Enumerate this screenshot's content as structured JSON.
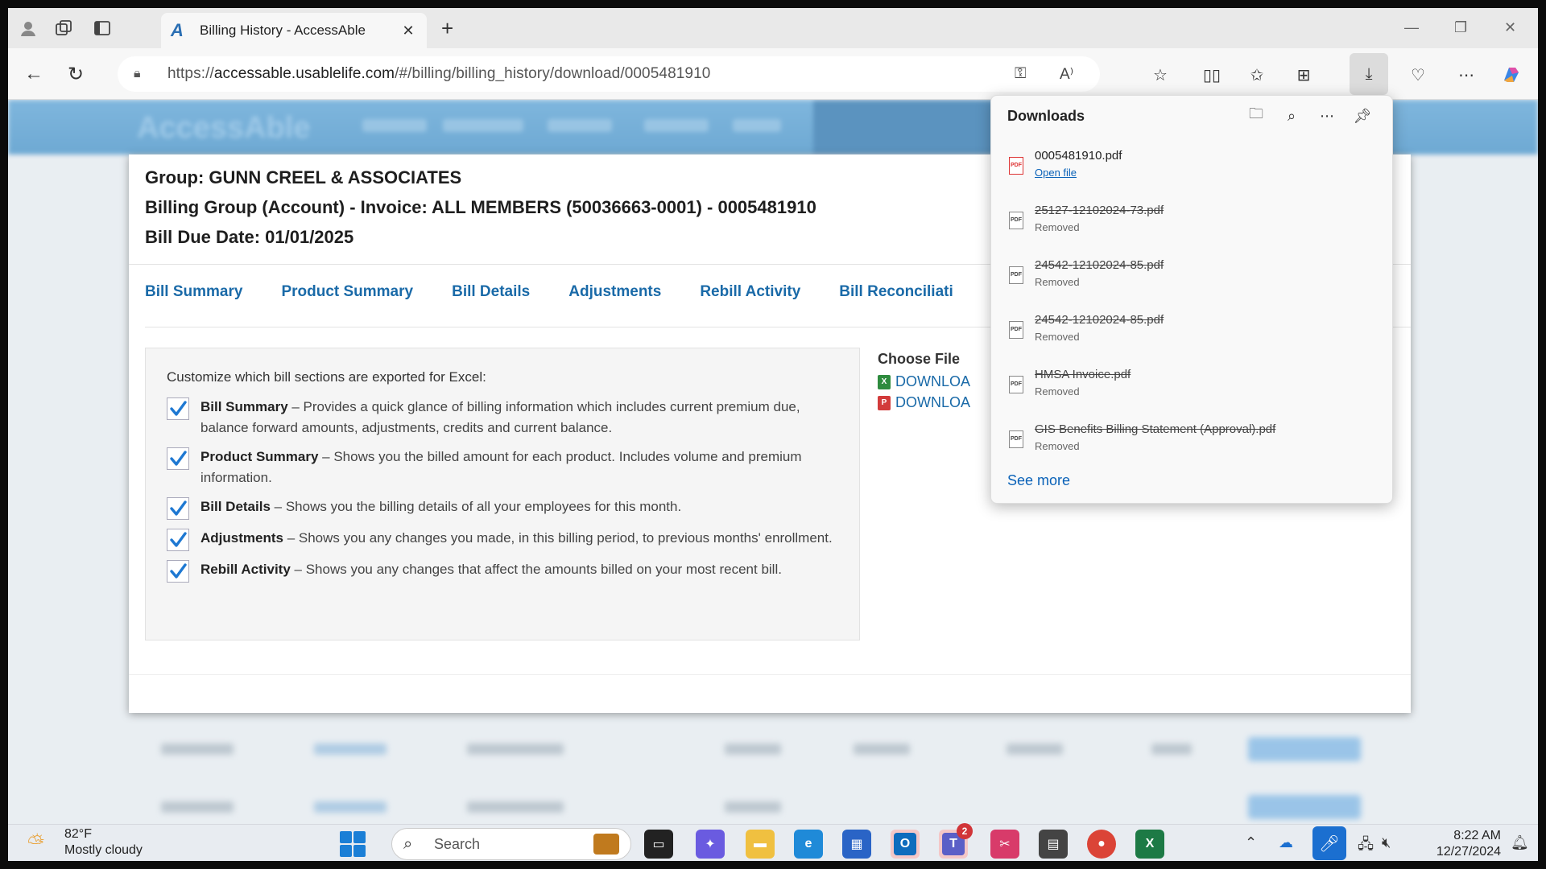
{
  "browser": {
    "tab_title": "Billing History - AccessAble",
    "tab_favicon": "A",
    "url_prefix": "https://",
    "url_host": "accessable.usablelife.com",
    "url_path": "/#/billing/billing_history/download/0005481910",
    "read_aloud": "A⁾"
  },
  "modal": {
    "group": "Group: GUNN CREEL & ASSOCIATES",
    "billing_group": "Billing Group (Account) - Invoice:  ALL MEMBERS (50036663-0001) - 0005481910",
    "due_date": "Bill Due Date: 01/01/2025",
    "tabs": [
      "Bill Summary",
      "Product Summary",
      "Bill Details",
      "Adjustments",
      "Rebill Activity",
      "Bill Reconciliati"
    ],
    "export_intro": "Customize which bill sections are exported for Excel:",
    "options": [
      {
        "title": "Bill Summary",
        "desc": " – Provides a quick glance of billing information which includes current premium due, balance forward amounts, adjustments, credits and current balance.",
        "checked": true
      },
      {
        "title": "Product Summary",
        "desc": " – Shows you the billed amount for each product. Includes volume and premium information.",
        "checked": true
      },
      {
        "title": "Bill Details",
        "desc": " – Shows you the billing details of all your employees for this month.",
        "checked": true
      },
      {
        "title": "Adjustments",
        "desc": " – Shows you any changes you made, in this billing period, to previous months' enrollment.",
        "checked": true
      },
      {
        "title": "Rebill Activity",
        "desc": " – Shows you any changes that affect the amounts billed on your most recent bill.",
        "checked": true
      }
    ],
    "choose_file": "Choose File",
    "download_excel": "DOWNLOA",
    "download_pdf": "DOWNLOA"
  },
  "downloads": {
    "title": "Downloads",
    "items": [
      {
        "name": "0005481910.pdf",
        "status": "Open file",
        "removed": false
      },
      {
        "name": "25127-12102024-73.pdf",
        "status": "Removed",
        "removed": true
      },
      {
        "name": "24542-12102024-85.pdf",
        "status": "Removed",
        "removed": true
      },
      {
        "name": "24542-12102024-85.pdf",
        "status": "Removed",
        "removed": true
      },
      {
        "name": "HMSA Invoice.pdf",
        "status": "Removed",
        "removed": true
      },
      {
        "name": "GIS Benefits Billing Statement (Approval).pdf",
        "status": "Removed",
        "removed": true
      }
    ],
    "see_more": "See more"
  },
  "taskbar": {
    "temp": "82°F",
    "weather": "Mostly cloudy",
    "search_placeholder": "Search",
    "teams_badge": "2",
    "time": "8:22 AM",
    "date": "12/27/2024"
  },
  "colors": {
    "link": "#1a6aa8",
    "accent": "#1b6fd0",
    "check": "#1e78d2"
  }
}
